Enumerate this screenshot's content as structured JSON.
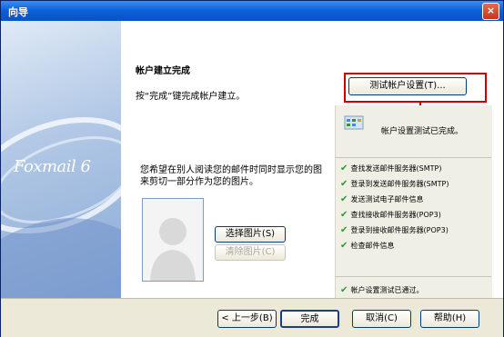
{
  "window": {
    "title": "向导",
    "close_label": "×"
  },
  "sidebar": {
    "logo_text": "Foxmail 6"
  },
  "main": {
    "heading": "帐户建立完成",
    "instruction": "按“完成”键完成帐户建立。",
    "picture_note_line1": "您希望在别人阅读您的邮件时同时显示您的图",
    "picture_note_line2": "来剪切一部分作为您的图片。",
    "select_picture_label": "选择图片(S)",
    "clear_picture_label": "清除图片(C)"
  },
  "test_panel": {
    "test_button_label": "测试帐户设置(T)...",
    "status_heading": "帐户设置测试已完成。",
    "steps": [
      "查找发送邮件服务器(SMTP)",
      "登录到发送邮件服务器(SMTP)",
      "发送测试电子邮件信息",
      "查找接收邮件服务器(POP3)",
      "登录到接收邮件服务器(POP3)",
      "检查邮件信息"
    ],
    "result": "帐户设置测试已通过。"
  },
  "footer": {
    "back_label": "< 上一步(B)",
    "finish_label": "完成",
    "cancel_label": "取消(C)",
    "help_label": "帮助(H)"
  },
  "colors": {
    "accent": "#0a5fd8",
    "highlight_border": "#cc0000",
    "check": "#2e9a2e"
  }
}
